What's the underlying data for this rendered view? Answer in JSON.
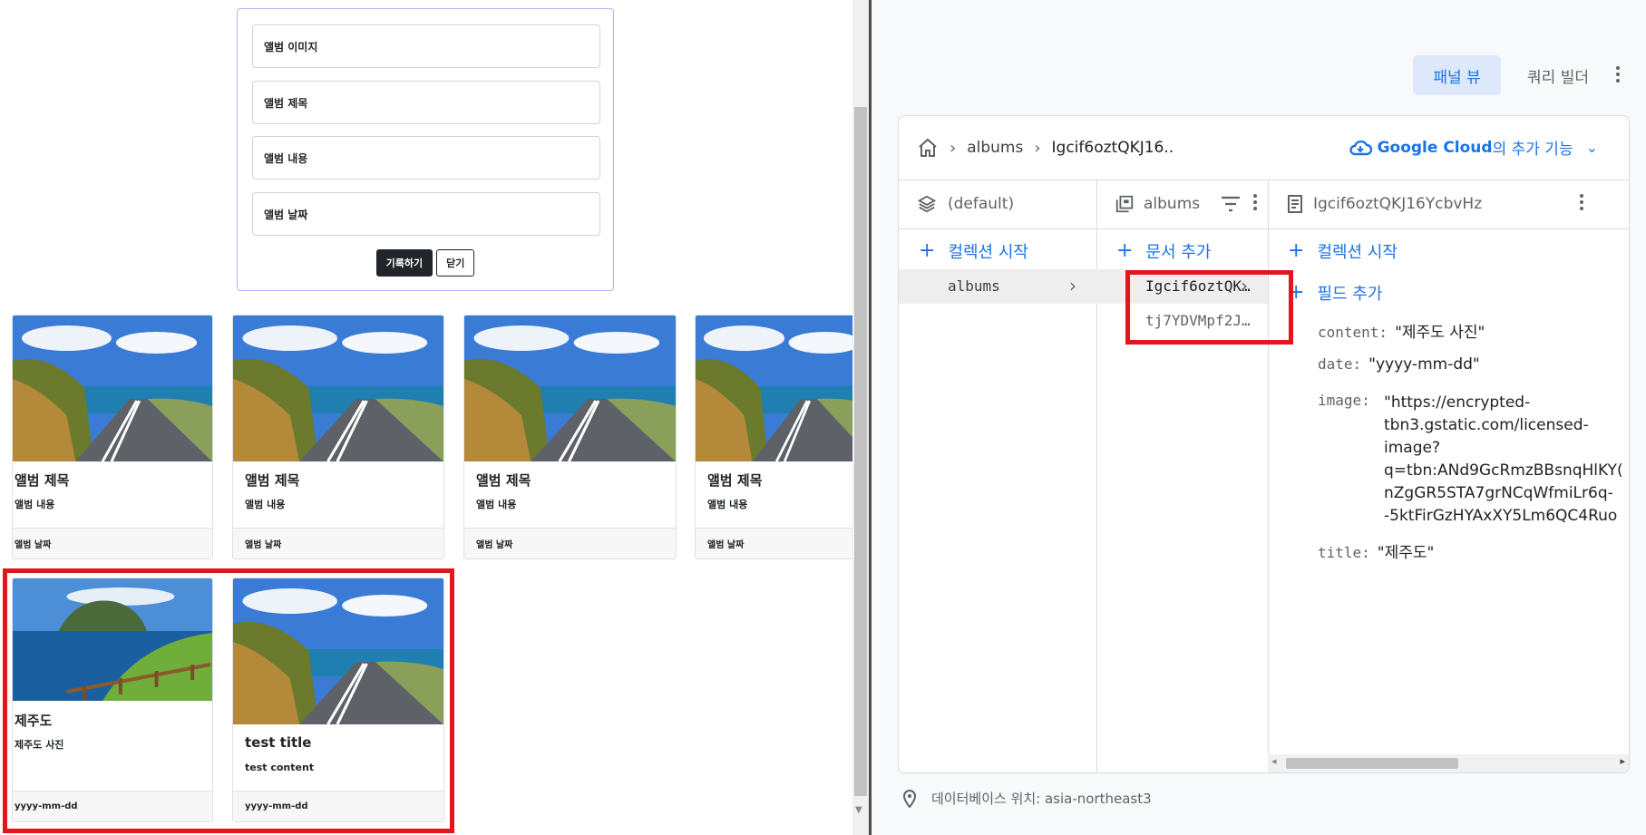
{
  "form": {
    "image_placeholder": "앨범 이미지",
    "title_placeholder": "앨범 제목",
    "content_placeholder": "앨범 내용",
    "date_placeholder": "앨범 날짜",
    "submit_label": "기록하기",
    "close_label": "닫기"
  },
  "cards": [
    {
      "title": "앨범 제목",
      "content": "앨범 내용",
      "date": "앨범 날짜"
    },
    {
      "title": "앨범 제목",
      "content": "앨범 내용",
      "date": "앨범 날짜"
    },
    {
      "title": "앨범 제목",
      "content": "앨범 내용",
      "date": "앨범 날짜"
    },
    {
      "title": "앨범 제목",
      "content": "앨범 내용",
      "date": "앨범 날짜"
    },
    {
      "title": "제주도",
      "content": "제주도 사진",
      "date": "yyyy-mm-dd"
    },
    {
      "title": "test title",
      "content": "test content",
      "date": "yyyy-mm-dd"
    }
  ],
  "toolbar": {
    "panel_view": "패널 뷰",
    "query_builder": "쿼리 빌더"
  },
  "breadcrumb": {
    "collection": "albums",
    "document": "Igcif6oztQKJ16.."
  },
  "gcloud": {
    "brand": "Google Cloud",
    "suffix": "의 추가 기능"
  },
  "columns": {
    "root": {
      "title": "(default)",
      "add_label": "컬렉션 시작",
      "items": [
        "albums"
      ]
    },
    "collection": {
      "title": "albums",
      "add_label": "문서 추가",
      "items": [
        "Igcif6oztQK…",
        "tj7YDVMpf2J…"
      ]
    },
    "document": {
      "title": "Igcif6oztQKJ16YcbvHz",
      "add_collection_label": "컬렉션 시작",
      "add_field_label": "필드 추가",
      "fields": [
        {
          "key": "content:",
          "value": "\"제주도 사진\""
        },
        {
          "key": "date:",
          "value": "\"yyyy-mm-dd\""
        },
        {
          "key": "image:",
          "value_lines": [
            "\"https://encrypted-",
            "tbn3.gstatic.com/licensed-",
            "image?",
            "q=tbn:ANd9GcRmzBBsnqHlKY(",
            "nZgGR5STA7grNCqWfmiLr6q-",
            "-5ktFirGzHYAxXY5Lm6QC4Ruo"
          ]
        },
        {
          "key": "title:",
          "value": "\"제주도\""
        }
      ]
    }
  },
  "footer": {
    "location": "데이터베이스 위치: asia-northeast3"
  },
  "colors": {
    "accent": "#1a73e8",
    "highlight": "#e3161b",
    "dark_button": "#212529"
  }
}
